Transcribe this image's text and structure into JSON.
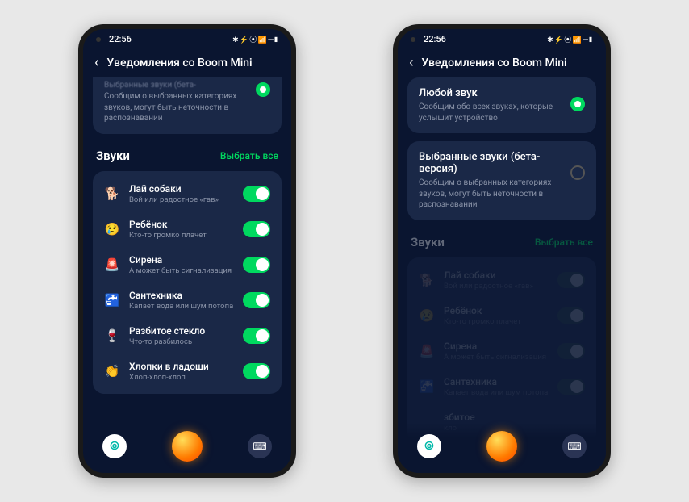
{
  "status": {
    "time": "22:56",
    "icons": "✱ ⚡ ⦿ 📶 ⎓▮"
  },
  "header": {
    "title": "Уведомления со Boom Mini"
  },
  "optionA": {
    "partial_hint": "Выбранные звуки (бета-",
    "sub": "Сообщим о выбранных категориях звуков, могут быть неточности в распознавании"
  },
  "optionB_any": {
    "title": "Любой звук",
    "sub": "Сообщим обо всех звуках, которые услышит устройство"
  },
  "optionB_selected": {
    "title": "Выбранные звуки (бета-версия)",
    "sub": "Сообщим о выбранных категориях звуков, могут быть неточности в распознавании"
  },
  "section": {
    "title": "Звуки",
    "select_all": "Выбрать все"
  },
  "sounds": [
    {
      "icon": "🐕",
      "title": "Лай собаки",
      "sub": "Вой или радостное «гав»"
    },
    {
      "icon": "😢",
      "title": "Ребёнок",
      "sub": "Кто-то громко плачет"
    },
    {
      "icon": "🚨",
      "title": "Сирена",
      "sub": "А может быть сигнализация"
    },
    {
      "icon": "🚰",
      "title": "Сантехника",
      "sub": "Капает вода или шум потопа"
    },
    {
      "icon": "🍷",
      "title": "Разбитое стекло",
      "sub": "Что-то разбилось"
    },
    {
      "icon": "👏",
      "title": "Хлопки в ладоши",
      "sub": "Хлоп-хлоп-хлоп"
    }
  ],
  "sounds_b_trunc": {
    "title": "збитое",
    "sub": "кло"
  }
}
